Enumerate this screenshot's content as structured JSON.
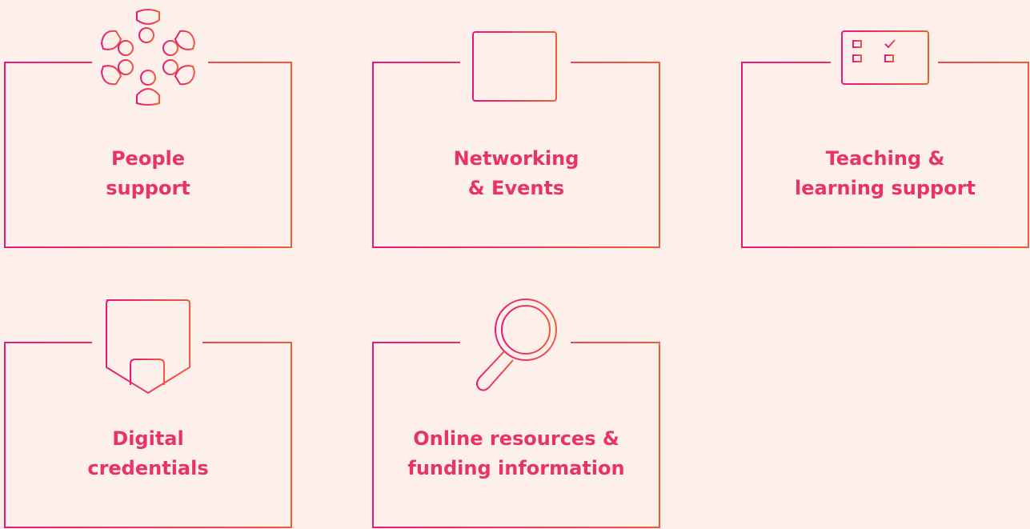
{
  "colors": {
    "background": "#fdefea",
    "gradient_start": "#e5197a",
    "gradient_end": "#f15a3a",
    "text": "#e8336a"
  },
  "cards": [
    {
      "icon": "people-group-icon",
      "lines": [
        "People",
        "support"
      ]
    },
    {
      "icon": "calendar-icon",
      "lines": [
        "Networking",
        "& Events"
      ]
    },
    {
      "icon": "monitor-checklist-icon",
      "lines": [
        "Teaching &",
        "learning support"
      ]
    },
    {
      "icon": "badge-credential-icon",
      "lines": [
        "Digital",
        "credentials"
      ]
    },
    {
      "icon": "magnifying-glass-icon",
      "lines": [
        "Online resources &",
        "funding information"
      ]
    }
  ]
}
